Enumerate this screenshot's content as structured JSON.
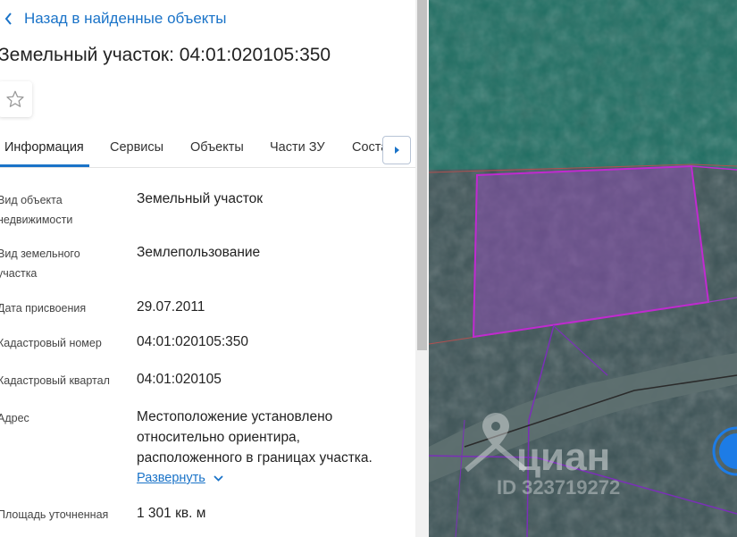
{
  "back_link": "Назад в найденные объекты",
  "title": "Земельный участок: 04:01:020105:350",
  "tabs": [
    {
      "label": "Информация"
    },
    {
      "label": "Сервисы"
    },
    {
      "label": "Объекты"
    },
    {
      "label": "Части ЗУ"
    },
    {
      "label": "Соста"
    }
  ],
  "fields": {
    "type": {
      "label": "Вид объекта недвижимости",
      "value": "Земельный участок"
    },
    "land_type": {
      "label": "Вид земельного участка",
      "value": "Землепользование"
    },
    "date": {
      "label": "Дата присвоения",
      "value": "29.07.2011"
    },
    "cadastral_number": {
      "label": "Кадастровый номер",
      "value": "04:01:020105:350"
    },
    "cadastral_quarter": {
      "label": "Кадастровый квартал",
      "value": "04:01:020105"
    },
    "address": {
      "label": "Адрес",
      "value": "Местоположение установлено относительно ориентира, расположенного в границах участка."
    },
    "area": {
      "label": "Площадь уточненная",
      "value": "1 301 кв. м"
    }
  },
  "expand_label": "Развернуть",
  "watermark": {
    "brand": "циан",
    "id_text": "ID 323719272"
  },
  "colors": {
    "accent": "#1a73c8",
    "parcel_fill": "#8a4fb0",
    "parcel_border": "#c02ad0"
  },
  "icons": {
    "back": "chevron-left-icon",
    "favorite": "star-outline-icon",
    "tab_next": "caret-right-icon",
    "expand": "chevron-down-icon"
  }
}
